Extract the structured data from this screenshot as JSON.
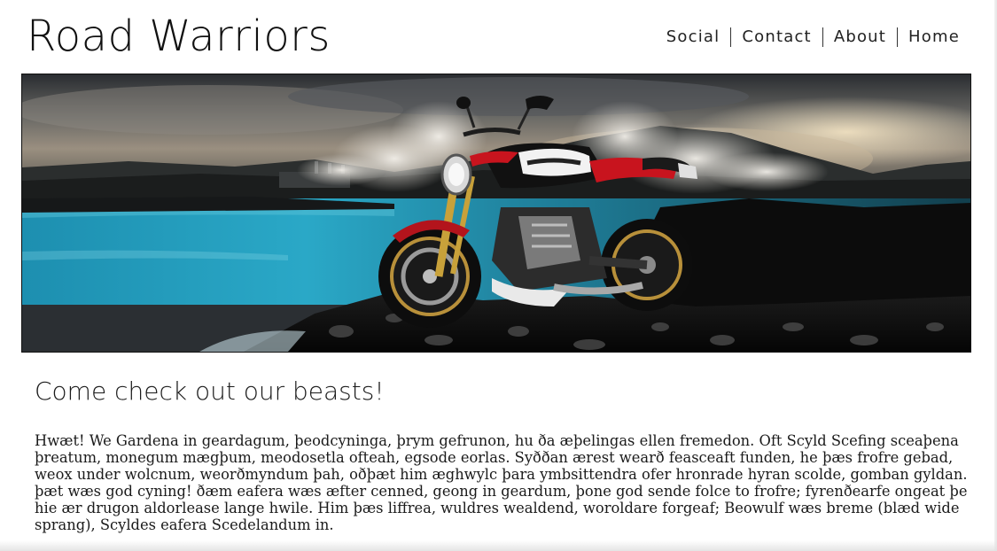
{
  "header": {
    "site_title": "Road Warriors"
  },
  "nav": {
    "items": [
      {
        "label": "Social"
      },
      {
        "label": "Contact"
      },
      {
        "label": "About"
      },
      {
        "label": "Home"
      }
    ]
  },
  "hero": {
    "alt": "Black and red sport motorcycle parked on dark volcanic rocks beside a turquoise geothermal lagoon with steam rising"
  },
  "main": {
    "heading": "Come check out our beasts!",
    "paragraph": "Hwæt! We Gardena in geardagum, þeodcyninga, þrym gefrunon, hu ða æþelingas ellen fremedon. Oft Scyld Scefing sceaþena þreatum, monegum mægþum, meodosetla ofteah, egsode eorlas. Syððan ærest wearð feasceaft funden, he þæs frofre gebad, weox under wolcnum, weorðmyndum þah, oðþæt him æghwylc þara ymbsittendra ofer hronrade hyran scolde, gomban gyldan. þæt wæs god cyning! ðæm eafera wæs æfter cenned, geong in geardum, þone god sende folce to frofre; fyrenðearfe ongeat þe hie ær drugon aldorlease lange hwile. Him þæs liffrea, wuldres wealdend, woroldare forgeaf; Beowulf wæs breme (blæd wide sprang), Scyldes eafera Scedelandum in."
  }
}
